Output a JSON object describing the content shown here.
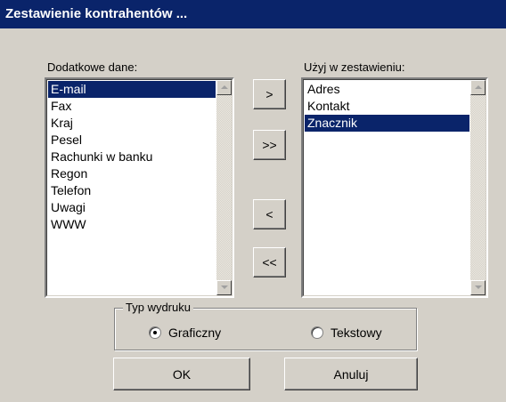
{
  "window": {
    "title": "Zestawienie kontrahentów ..."
  },
  "available": {
    "label": "Dodatkowe dane:",
    "items": [
      "E-mail",
      "Fax",
      "Kraj",
      "Pesel",
      "Rachunki w banku",
      "Regon",
      "Telefon",
      "Uwagi",
      "WWW"
    ],
    "selected_index": 0
  },
  "used": {
    "label": "Użyj w zestawieniu:",
    "items": [
      "Adres",
      "Kontakt",
      "Znacznik"
    ],
    "selected_index": 2
  },
  "transfer_buttons": {
    "add_one": ">",
    "add_all": ">>",
    "remove_one": "<",
    "remove_all": "<<"
  },
  "print_type": {
    "legend": "Typ wydruku",
    "options": [
      "Graficzny",
      "Tekstowy"
    ],
    "selected": "Graficzny"
  },
  "buttons": {
    "ok": "OK",
    "cancel": "Anuluj"
  }
}
